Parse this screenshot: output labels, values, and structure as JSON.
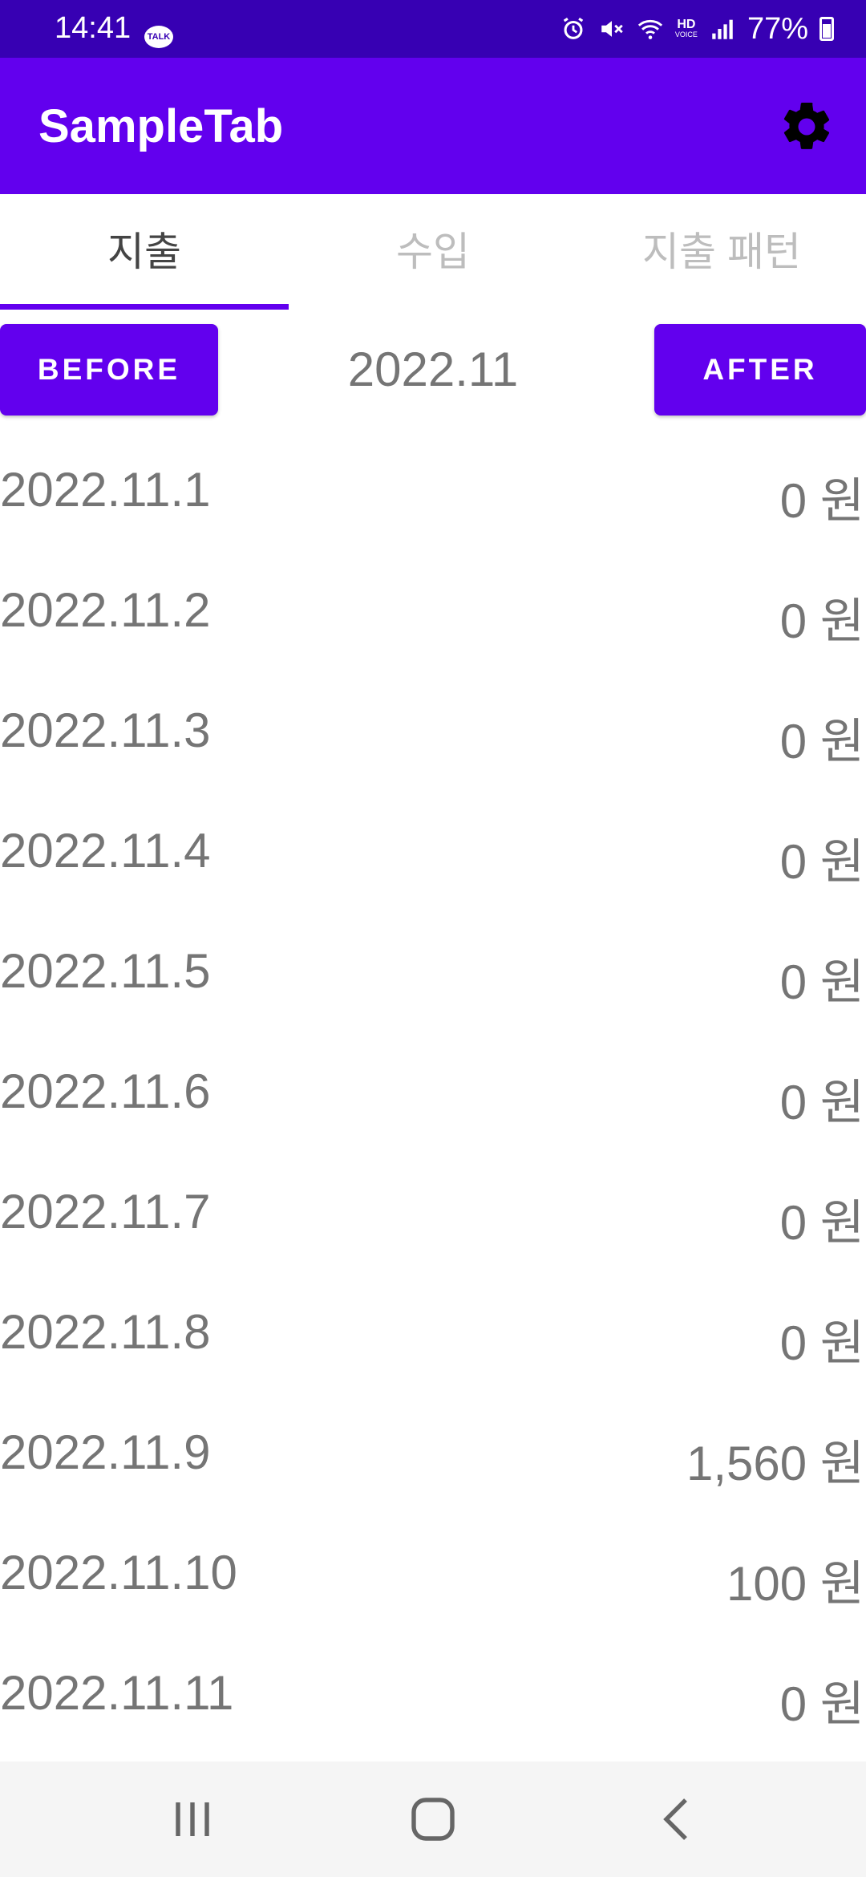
{
  "status_bar": {
    "time": "14:41",
    "talk_badge": "TALK",
    "hd_label": "HD",
    "voice_label": "VOICE",
    "battery": "77%",
    "icons": [
      "alarm-icon",
      "mute-icon",
      "wifi-icon",
      "hd-voice-icon",
      "signal-icon",
      "battery-icon"
    ]
  },
  "app_bar": {
    "title": "SampleTab",
    "settings_icon": "gear-icon"
  },
  "tabs": [
    {
      "label": "지출",
      "active": true
    },
    {
      "label": "수입",
      "active": false
    },
    {
      "label": "지출 패턴",
      "active": false
    }
  ],
  "month_nav": {
    "before_label": "BEFORE",
    "month": "2022.11",
    "after_label": "AFTER"
  },
  "entries": [
    {
      "date": "2022.11.1",
      "amount": "0 원"
    },
    {
      "date": "2022.11.2",
      "amount": "0 원"
    },
    {
      "date": "2022.11.3",
      "amount": "0 원"
    },
    {
      "date": "2022.11.4",
      "amount": "0 원"
    },
    {
      "date": "2022.11.5",
      "amount": "0 원"
    },
    {
      "date": "2022.11.6",
      "amount": "0 원"
    },
    {
      "date": "2022.11.7",
      "amount": "0 원"
    },
    {
      "date": "2022.11.8",
      "amount": "0 원"
    },
    {
      "date": "2022.11.9",
      "amount": "1,560 원"
    },
    {
      "date": "2022.11.10",
      "amount": "100 원"
    },
    {
      "date": "2022.11.11",
      "amount": "0 원"
    }
  ],
  "colors": {
    "status_bar": "#3700B3",
    "primary": "#6200EE",
    "text_gray": "#757575",
    "tab_inactive": "#BDBDBD"
  },
  "nav_bar": {
    "icons": [
      "recent-apps-icon",
      "home-icon",
      "back-icon"
    ]
  }
}
